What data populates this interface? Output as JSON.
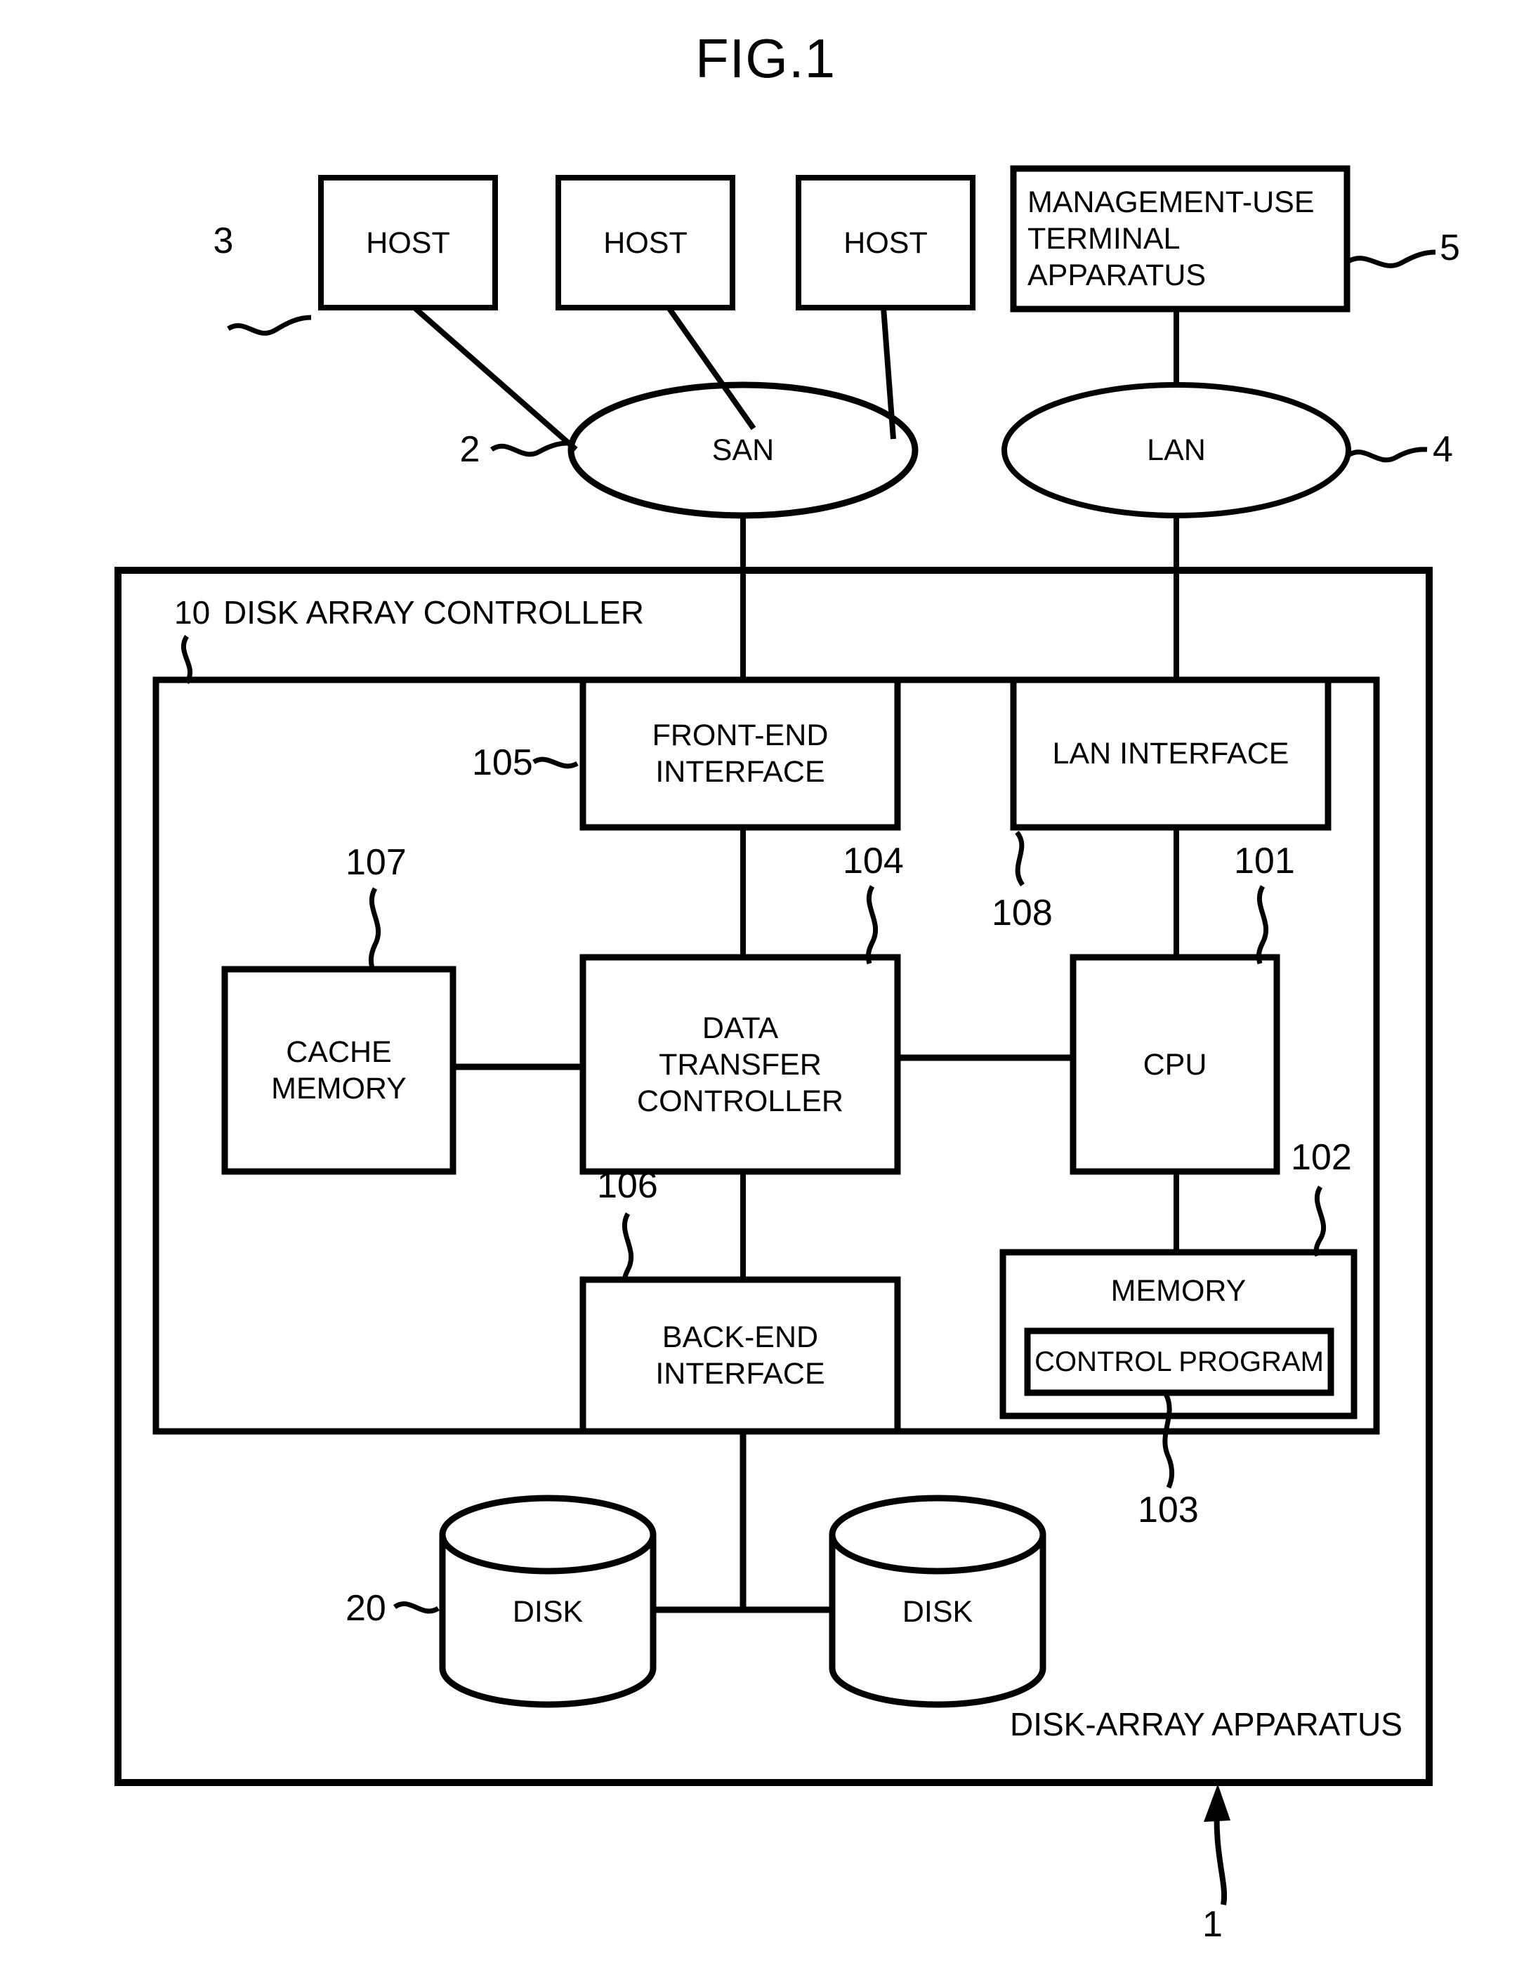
{
  "figure": {
    "title": "FIG.1"
  },
  "hosts": [
    {
      "label": "HOST",
      "ref": "3"
    },
    {
      "label": "HOST"
    },
    {
      "label": "HOST"
    }
  ],
  "management_terminal": {
    "label": "MANAGEMENT-USE\nTERMINAL\nAPPARATUS",
    "ref": "5"
  },
  "networks": [
    {
      "label": "SAN",
      "ref": "2"
    },
    {
      "label": "LAN",
      "ref": "4"
    }
  ],
  "controller": {
    "ref": "10",
    "label": "DISK ARRAY CONTROLLER",
    "blocks": [
      {
        "label": "FRONT-END\nINTERFACE",
        "ref": "105"
      },
      {
        "label": "LAN INTERFACE",
        "ref": "108"
      },
      {
        "label": "CACHE\nMEMORY",
        "ref": "107"
      },
      {
        "label": "DATA\nTRANSFER\nCONTROLLER",
        "ref": "104"
      },
      {
        "label": "CPU",
        "ref": "101"
      },
      {
        "label": "MEMORY",
        "ref": "102"
      },
      {
        "label": "CONTROL PROGRAM",
        "ref": "103"
      },
      {
        "label": "BACK-END\nINTERFACE",
        "ref": "106"
      }
    ]
  },
  "disks": [
    {
      "label": "DISK",
      "ref": "20"
    },
    {
      "label": "DISK"
    }
  ],
  "apparatus": {
    "label": "DISK-ARRAY APPARATUS",
    "ref": "1"
  },
  "style": {
    "stroke": "#000000",
    "background": "#ffffff"
  }
}
